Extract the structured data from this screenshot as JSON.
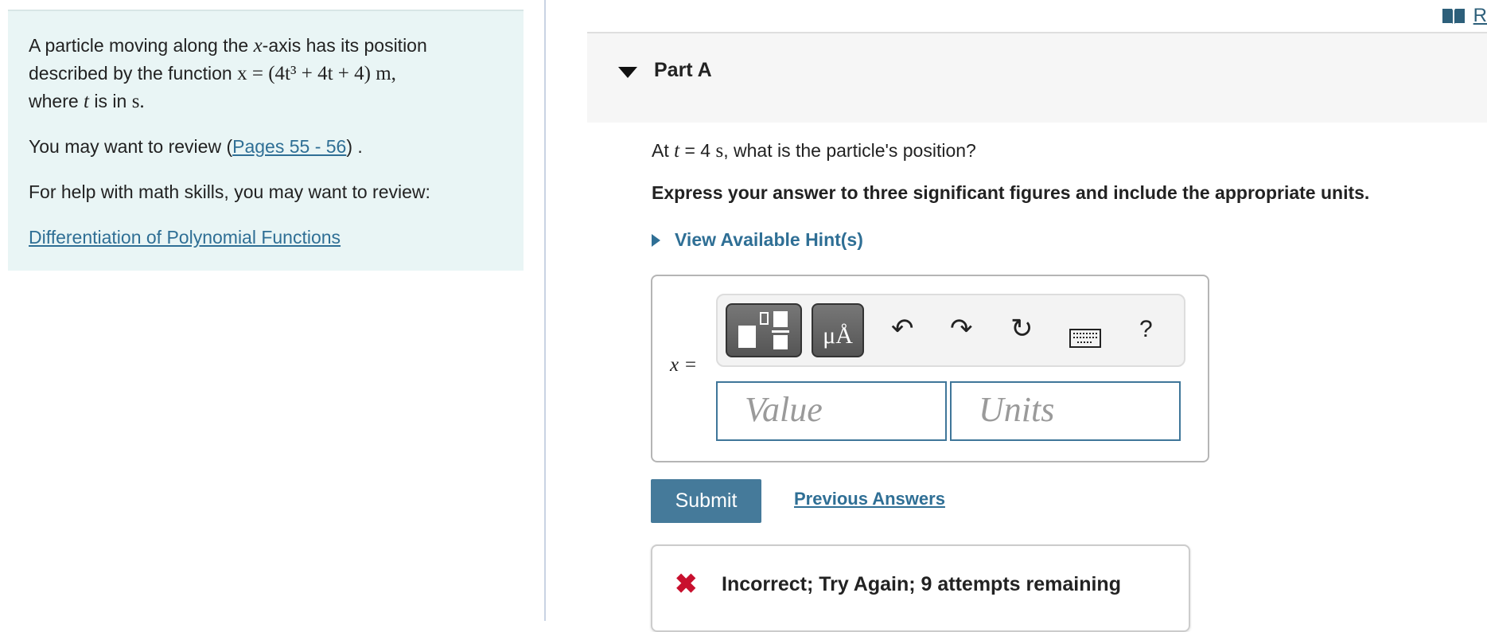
{
  "problem": {
    "line1_pre": "A particle moving along the ",
    "var_x": "x",
    "line1_post": "-axis has its position",
    "line2_pre": "described by the function ",
    "function": "x = (4t³ + 4t + 4) m,",
    "line3_pre": "where ",
    "var_t": "t",
    "line3_mid": " is in ",
    "unit_s": "s.",
    "review_pre": "You may want to review (",
    "review_link": "Pages 55 - 56",
    "review_post": ") .",
    "math_help": "For help with math skills, you may want to review:",
    "math_link": "Differentiation of Polynomial Functions"
  },
  "topbar": {
    "icon": "book-icon",
    "link": "R"
  },
  "part": {
    "title": "Part A",
    "question_pre": "At ",
    "question_var": "t",
    "question_eq": " = 4 ",
    "question_unit": "s",
    "question_post": ", what is the particle's position?",
    "instruction": "Express your answer to three significant figures and include the appropriate units.",
    "hint_label": "View Available Hint(s)"
  },
  "answer": {
    "toolbar": {
      "units_btn": "μÅ",
      "help": "?"
    },
    "label": "x =",
    "value_placeholder": "Value",
    "units_placeholder": "Units"
  },
  "actions": {
    "submit": "Submit",
    "previous_answers": "Previous Answers"
  },
  "feedback": {
    "icon": "x-icon",
    "message": "Incorrect; Try Again; 9 attempts remaining",
    "color": "#c8102e"
  }
}
